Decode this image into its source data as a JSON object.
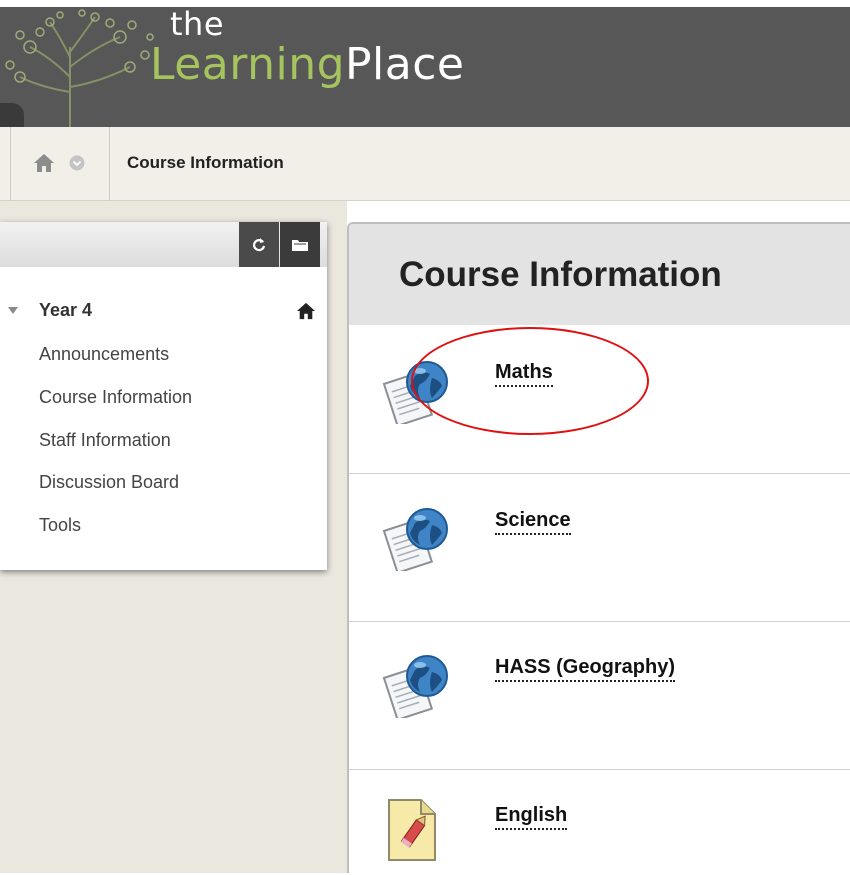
{
  "header": {
    "logo_the": "the",
    "logo_learning": "Learning",
    "logo_place": "Place"
  },
  "breadcrumb": {
    "home_icon": "home-icon",
    "menu_icon": "chevron-down-icon",
    "current": "Course Information"
  },
  "course_menu": {
    "toolbar": {
      "refresh_icon": "refresh-icon",
      "folder_icon": "folder-icon"
    },
    "root_label": "Year 4",
    "root_home_icon": "home-icon",
    "items": [
      {
        "label": "Announcements"
      },
      {
        "label": "Course Information"
      },
      {
        "label": "Staff Information"
      },
      {
        "label": "Discussion Board"
      },
      {
        "label": "Tools"
      }
    ]
  },
  "content": {
    "title": "Course Information",
    "items": [
      {
        "label": "Maths",
        "icon": "web-link-icon"
      },
      {
        "label": "Science",
        "icon": "web-link-icon"
      },
      {
        "label": "HASS (Geography)",
        "icon": "web-link-icon"
      },
      {
        "label": "English",
        "icon": "document-icon"
      }
    ]
  },
  "annotation": {
    "color": "#e01010",
    "target": "Maths"
  },
  "colors": {
    "banner": "#575757",
    "logo_green": "#a6c45e",
    "crumb_bg": "#f1efe8",
    "left_bg": "#eae7df",
    "content_head": "#e3e3e3"
  }
}
